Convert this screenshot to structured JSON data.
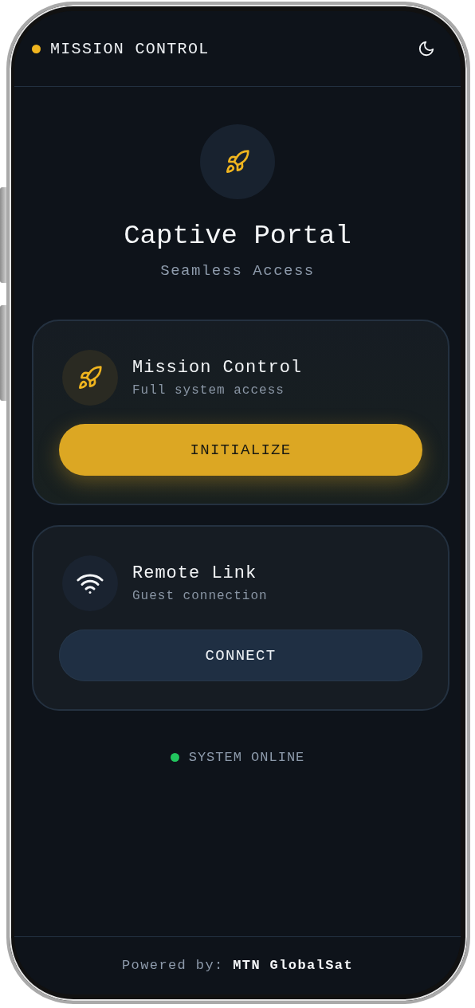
{
  "header": {
    "title": "MISSION CONTROL",
    "color": "#f0b51f"
  },
  "hero": {
    "title": "Captive Portal",
    "subtitle": "Seamless Access"
  },
  "cards": [
    {
      "kind": "rocket",
      "title": "Mission Control",
      "subtitle": "Full system access",
      "button": "INITIALIZE",
      "highlighted": true
    },
    {
      "kind": "wifi",
      "title": "Remote Link",
      "subtitle": "Guest connection",
      "button": "CONNECT",
      "highlighted": false
    }
  ],
  "status": {
    "label": "SYSTEM ONLINE",
    "color": "#22c55e"
  },
  "footer": {
    "text": "Powered by: **MTN GlobalSat**"
  }
}
